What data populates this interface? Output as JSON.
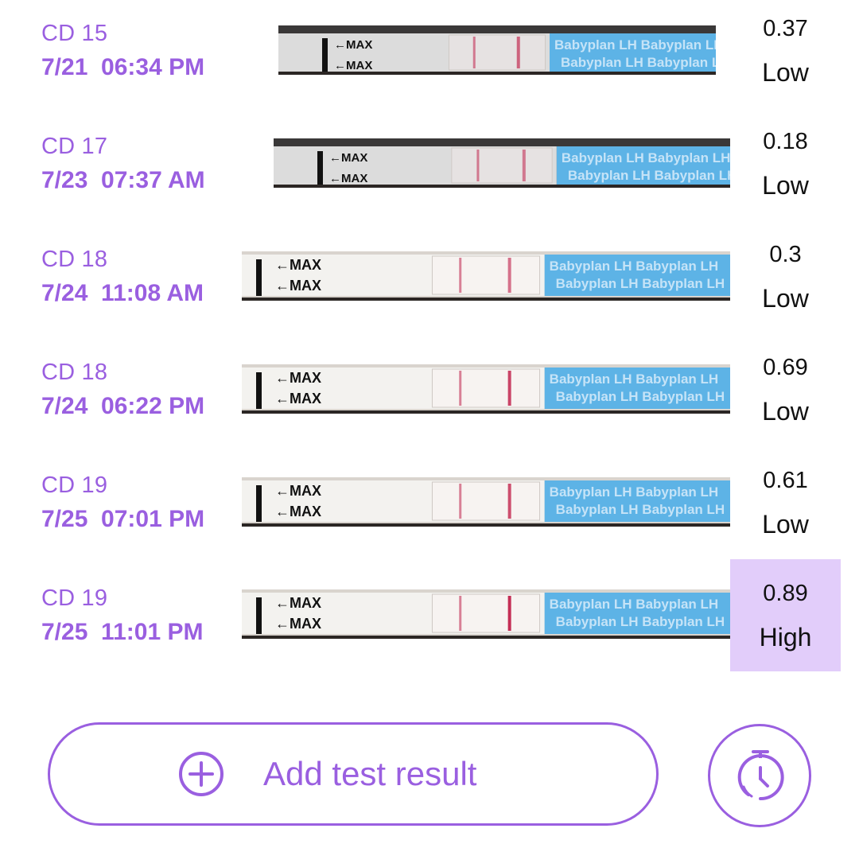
{
  "colors": {
    "accent": "#9a5fe0",
    "high_highlight": "#e2cdfa",
    "text": "#111111",
    "strip_blue": "#5db3e6",
    "test_line": "#c0204a"
  },
  "strip_brand": "Babyplan LH",
  "strip_max": "MAX",
  "results": [
    {
      "cd": "CD 15",
      "datetime": "7/21  06:34 PM",
      "value": "0.37",
      "level": "Low",
      "line_intensity": 0.37
    },
    {
      "cd": "CD 17",
      "datetime": "7/23  07:37 AM",
      "value": "0.18",
      "level": "Low",
      "line_intensity": 0.18
    },
    {
      "cd": "CD 18",
      "datetime": "7/24  11:08 AM",
      "value": "0.3",
      "level": "Low",
      "line_intensity": 0.3
    },
    {
      "cd": "CD 18",
      "datetime": "7/24  06:22 PM",
      "value": "0.69",
      "level": "Low",
      "line_intensity": 0.69
    },
    {
      "cd": "CD 19",
      "datetime": "7/25  07:01 PM",
      "value": "0.61",
      "level": "Low",
      "line_intensity": 0.61
    },
    {
      "cd": "CD 19",
      "datetime": "7/25  11:01 PM",
      "value": "0.89",
      "level": "High",
      "line_intensity": 0.89
    }
  ],
  "actions": {
    "add_label": "Add test result",
    "add_icon": "plus-circle-icon",
    "timer_icon": "stopwatch-icon"
  }
}
